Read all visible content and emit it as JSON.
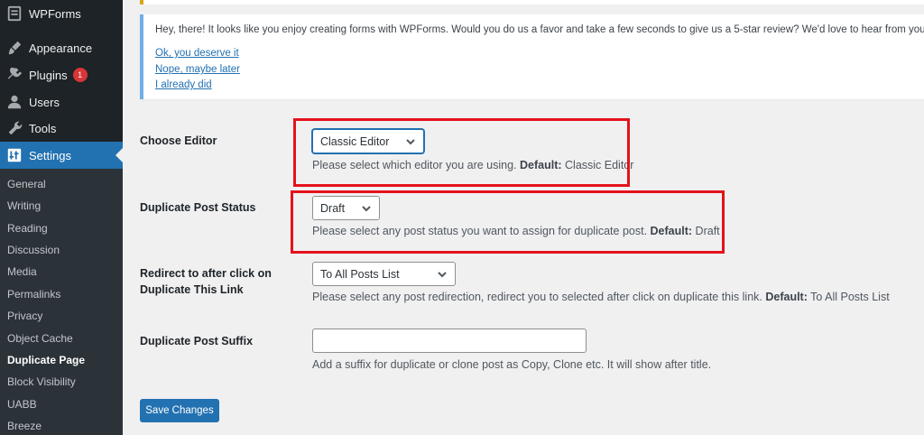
{
  "sidebar": {
    "menu": [
      {
        "label": "WPForms",
        "icon": "wpforms-icon",
        "badge": ""
      },
      {
        "label": "Appearance",
        "icon": "paintbrush-icon",
        "badge": ""
      },
      {
        "label": "Plugins",
        "icon": "plugins-icon",
        "badge": "1"
      },
      {
        "label": "Users",
        "icon": "users-icon",
        "badge": ""
      },
      {
        "label": "Tools",
        "icon": "wrench-icon",
        "badge": ""
      },
      {
        "label": "Settings",
        "icon": "settings-icon",
        "badge": ""
      }
    ],
    "submenu": [
      "General",
      "Writing",
      "Reading",
      "Discussion",
      "Media",
      "Permalinks",
      "Privacy",
      "Object Cache",
      "Duplicate Page",
      "Block Visibility",
      "UABB",
      "Breeze"
    ],
    "current_submenu": "Duplicate Page"
  },
  "notice": {
    "text": "Hey, there! It looks like you enjoy creating forms with WPForms. Would you do us a favor and take a few seconds to give us a 5-star review? We'd love to hear from you.",
    "links": [
      "Ok, you deserve it",
      "Nope, maybe later",
      "I already did"
    ]
  },
  "settings": {
    "editor": {
      "label": "Choose Editor",
      "value": "Classic Editor",
      "desc": "Please select which editor you are using.",
      "default_label": "Default:",
      "default_value": "Classic Editor"
    },
    "status": {
      "label": "Duplicate Post Status",
      "value": "Draft",
      "desc": "Please select any post status you want to assign for duplicate post.",
      "default_label": "Default:",
      "default_value": "Draft"
    },
    "redirect": {
      "label_line1": "Redirect to after click on",
      "label_line2": "Duplicate This Link",
      "value": "To All Posts List",
      "desc": "Please select any post redirection, redirect you to selected after click on duplicate this link.",
      "default_label": "Default:",
      "default_value": "To All Posts List"
    },
    "suffix": {
      "label": "Duplicate Post Suffix",
      "value": "",
      "desc": "Add a suffix for duplicate or clone post as Copy, Clone etc. It will show after title."
    }
  },
  "save_label": "Save Changes",
  "colors": {
    "sidebar_bg": "#1d2327",
    "accent": "#2271b1",
    "highlight_box": "#e3121b",
    "badge": "#d63638"
  }
}
